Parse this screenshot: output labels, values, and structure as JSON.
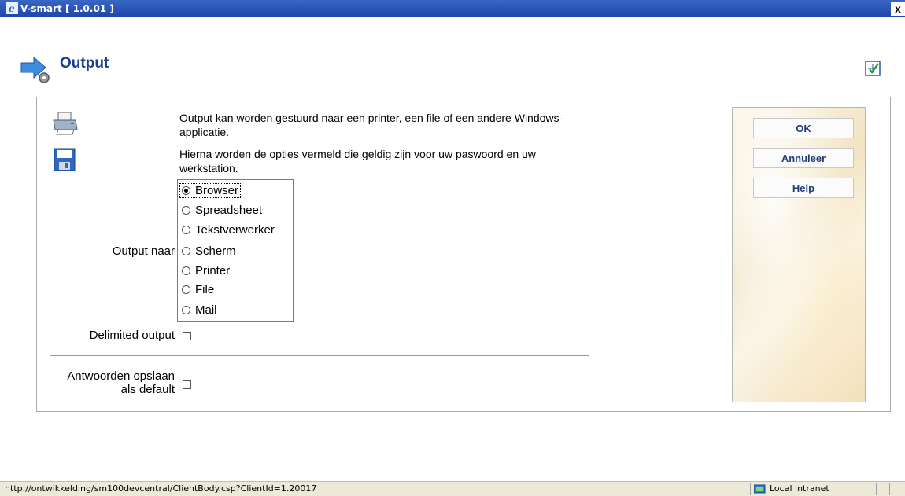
{
  "window": {
    "title": "V-smart [ 1.0.01 ]",
    "close_label": "x"
  },
  "header": {
    "title": "Output"
  },
  "info": {
    "line1": "Output kan worden gestuurd naar een printer, een file of een andere Windows-applicatie.",
    "line2": "Hierna worden de opties vermeld die geldig zijn voor uw paswoord en uw werkstation."
  },
  "form": {
    "output_naar_label": "Output naar",
    "options": [
      "Browser",
      "Spreadsheet",
      "Tekstverwerker",
      "Scherm",
      "Printer",
      "File",
      "Mail"
    ],
    "selected": "Browser",
    "delimited_label": "Delimited output",
    "antwoorden_label": "Antwoorden opslaan als default"
  },
  "buttons": {
    "ok": "OK",
    "annuleer": "Annuleer",
    "help": "Help"
  },
  "statusbar": {
    "url": "http://ontwikkelding/sm100devcentral/ClientBody.csp?ClientId=1.20017",
    "zone": "Local intranet"
  },
  "icons": [
    "ie-icon",
    "arrow-gear-icon",
    "checklist-icon",
    "printer-icon",
    "floppy-disk-icon",
    "globe-intranet-icon"
  ],
  "colors": {
    "title_blue": "#1c3f94",
    "titlebar": "#1c45a8"
  }
}
